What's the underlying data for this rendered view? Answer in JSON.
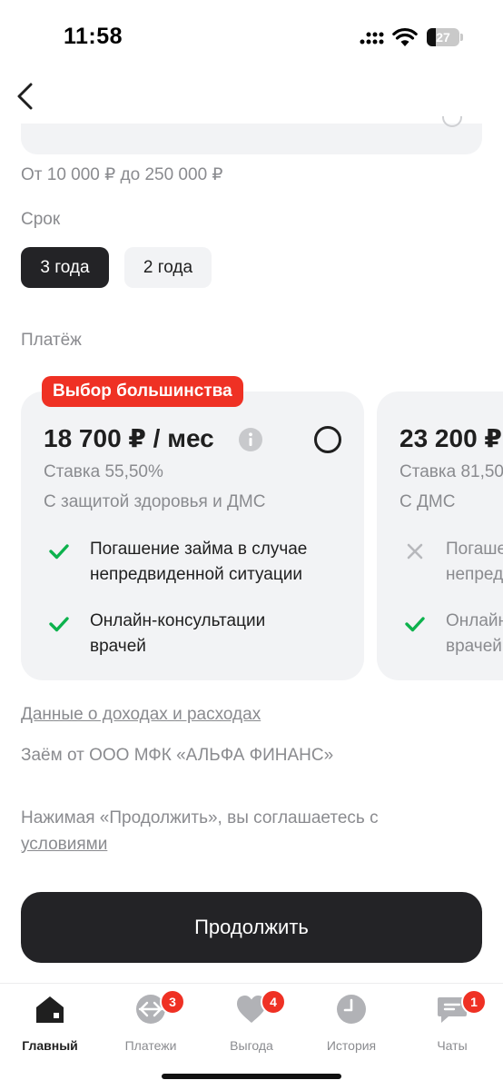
{
  "status_bar": {
    "time": "11:58",
    "battery": "27"
  },
  "amount": {
    "range": "От 10 000 ₽ до 250 000 ₽"
  },
  "term": {
    "label": "Срок",
    "options": [
      {
        "label": "3 года",
        "selected": true
      },
      {
        "label": "2 года",
        "selected": false
      }
    ]
  },
  "payment": {
    "label": "Платёж",
    "cards": [
      {
        "badge": "Выбор большинства",
        "price": "18 700 ₽ / мес",
        "rate": "Ставка 55,50%",
        "subtitle": "С защитой здоровья и ДМС",
        "features": [
          {
            "included": true,
            "line1": "Погашение займа в случае",
            "line2": "непредвиденной ситуации"
          },
          {
            "included": true,
            "line1": "Онлайн-консультации",
            "line2": "врачей"
          }
        ]
      },
      {
        "price": "23 200 ₽",
        "rate": "Ставка 81,50",
        "subtitle": "С ДМС",
        "features": [
          {
            "included": false,
            "line1": "Погаше",
            "line2": "непред"
          },
          {
            "included": true,
            "line1": "Онлайн",
            "line2": "врачей"
          }
        ]
      }
    ]
  },
  "links": {
    "income": "Данные о доходах и расходах",
    "lender": "Заём от ООО МФК «АЛЬФА ФИНАНС»",
    "consent_prefix": "Нажимая «Продолжить», вы соглашаетесь с",
    "consent_link": "условиями"
  },
  "continue_label": "Продолжить",
  "tabbar": {
    "items": [
      {
        "label": "Главный",
        "icon": "home-icon",
        "badge": "",
        "active": true
      },
      {
        "label": "Платежи",
        "icon": "payments-icon",
        "badge": "3",
        "active": false
      },
      {
        "label": "Выгода",
        "icon": "heart-icon",
        "badge": "4",
        "active": false
      },
      {
        "label": "История",
        "icon": "clock-icon",
        "badge": "",
        "active": false
      },
      {
        "label": "Чаты",
        "icon": "chat-icon",
        "badge": "1",
        "active": false
      }
    ]
  },
  "colors": {
    "accent": "#ef3124",
    "dark": "#232326",
    "check": "#0db24d",
    "surface": "#f2f3f5"
  }
}
